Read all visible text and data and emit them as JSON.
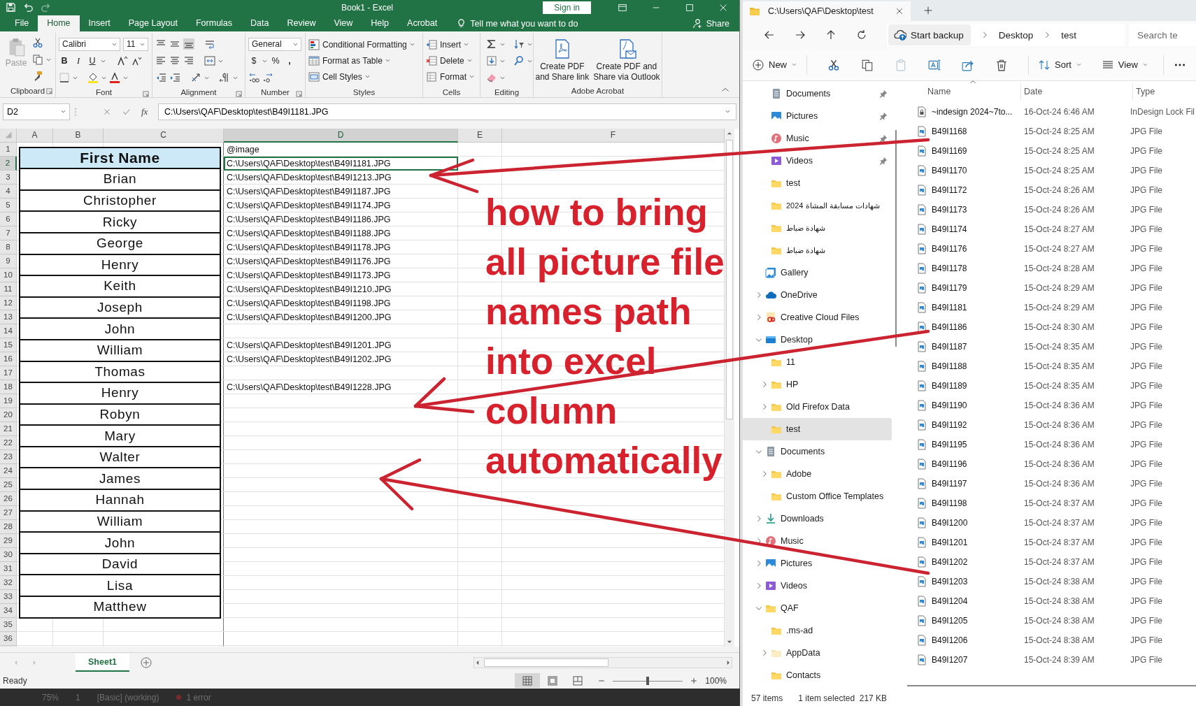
{
  "excel": {
    "title": "Book1 - Excel",
    "sign_in": "Sign in",
    "tabs": [
      {
        "label": "File",
        "selected": false
      },
      {
        "label": "Home",
        "selected": true
      },
      {
        "label": "Insert",
        "selected": false
      },
      {
        "label": "Page Layout",
        "selected": false
      },
      {
        "label": "Formulas",
        "selected": false
      },
      {
        "label": "Data",
        "selected": false
      },
      {
        "label": "Review",
        "selected": false
      },
      {
        "label": "View",
        "selected": false
      },
      {
        "label": "Help",
        "selected": false
      },
      {
        "label": "Acrobat",
        "selected": false
      }
    ],
    "tell_me": "Tell me what you want to do",
    "share": "Share",
    "ribbon": {
      "clipboard": {
        "label": "Clipboard",
        "paste": "Paste"
      },
      "font": {
        "label": "Font",
        "name": "Calibri",
        "size": "11",
        "bold": "B",
        "italic": "I",
        "underline": "U"
      },
      "alignment": {
        "label": "Alignment"
      },
      "number": {
        "label": "Number",
        "format": "General",
        "currency": "$",
        "percent": "%",
        "comma": ","
      },
      "styles": {
        "label": "Styles",
        "items": [
          "Conditional Formatting",
          "Format as Table",
          "Cell Styles"
        ]
      },
      "cells": {
        "label": "Cells",
        "items": [
          "Insert",
          "Delete",
          "Format"
        ]
      },
      "editing": {
        "label": "Editing"
      },
      "acrobat": {
        "label": "Adobe Acrobat",
        "items": [
          "Create PDF\nand Share link",
          "Create PDF and\nShare via Outlook"
        ]
      }
    },
    "name_box": "D2",
    "fx": "fx",
    "formula": "C:\\Users\\QAF\\Desktop\\test\\B49I1181.JPG",
    "columns": [
      {
        "label": "A",
        "selected": false
      },
      {
        "label": "B",
        "selected": false
      },
      {
        "label": "C",
        "selected": false
      },
      {
        "label": "D",
        "selected": true
      },
      {
        "label": "E",
        "selected": false
      },
      {
        "label": "F",
        "selected": false
      }
    ],
    "rows": [
      {
        "number": "1",
        "selected": false,
        "d": "@image"
      },
      {
        "number": "2",
        "selected": true,
        "d": "C:\\Users\\QAF\\Desktop\\test\\B49I1181.JPG"
      },
      {
        "number": "3",
        "selected": false,
        "d": "C:\\Users\\QAF\\Desktop\\test\\B49I1213.JPG"
      },
      {
        "number": "4",
        "selected": false,
        "d": "C:\\Users\\QAF\\Desktop\\test\\B49I1187.JPG"
      },
      {
        "number": "5",
        "selected": false,
        "d": "C:\\Users\\QAF\\Desktop\\test\\B49I1174.JPG"
      },
      {
        "number": "6",
        "selected": false,
        "d": "C:\\Users\\QAF\\Desktop\\test\\B49I1186.JPG"
      },
      {
        "number": "7",
        "selected": false,
        "d": "C:\\Users\\QAF\\Desktop\\test\\B49I1188.JPG"
      },
      {
        "number": "8",
        "selected": false,
        "d": "C:\\Users\\QAF\\Desktop\\test\\B49I1178.JPG"
      },
      {
        "number": "9",
        "selected": false,
        "d": "C:\\Users\\QAF\\Desktop\\test\\B49I1176.JPG"
      },
      {
        "number": "10",
        "selected": false,
        "d": "C:\\Users\\QAF\\Desktop\\test\\B49I1173.JPG"
      },
      {
        "number": "11",
        "selected": false,
        "d": "C:\\Users\\QAF\\Desktop\\test\\B49I1210.JPG"
      },
      {
        "number": "12",
        "selected": false,
        "d": "C:\\Users\\QAF\\Desktop\\test\\B49I1198.JPG"
      },
      {
        "number": "13",
        "selected": false,
        "d": "C:\\Users\\QAF\\Desktop\\test\\B49I1200.JPG"
      },
      {
        "number": "14",
        "selected": false
      },
      {
        "number": "15",
        "selected": false,
        "d": "C:\\Users\\QAF\\Desktop\\test\\B49I1201.JPG"
      },
      {
        "number": "16",
        "selected": false,
        "d": "C:\\Users\\QAF\\Desktop\\test\\B49I1202.JPG"
      },
      {
        "number": "17",
        "selected": false
      },
      {
        "number": "18",
        "selected": false,
        "d": "C:\\Users\\QAF\\Desktop\\test\\B49I1228.JPG"
      },
      {
        "number": "19",
        "selected": false
      },
      {
        "number": "20",
        "selected": false
      },
      {
        "number": "21",
        "selected": false
      },
      {
        "number": "22",
        "selected": false
      },
      {
        "number": "23",
        "selected": false
      },
      {
        "number": "24",
        "selected": false
      },
      {
        "number": "25",
        "selected": false
      },
      {
        "number": "26",
        "selected": false
      },
      {
        "number": "27",
        "selected": false
      },
      {
        "number": "28",
        "selected": false
      },
      {
        "number": "29",
        "selected": false
      },
      {
        "number": "30",
        "selected": false
      },
      {
        "number": "31",
        "selected": false
      },
      {
        "number": "32",
        "selected": false
      },
      {
        "number": "33",
        "selected": false
      },
      {
        "number": "34",
        "selected": false
      },
      {
        "number": "35",
        "selected": false
      },
      {
        "number": "36",
        "selected": false
      }
    ],
    "name_table": {
      "header": "First Name",
      "names": [
        "Brian",
        "Christopher",
        "Ricky",
        "George",
        "Henry",
        "Keith",
        "Joseph",
        "John",
        "William",
        "Thomas",
        "Henry",
        "Robyn",
        "Mary",
        "Walter",
        "James",
        "Hannah",
        "William",
        "John",
        "David",
        "Lisa",
        "Matthew"
      ]
    },
    "sheet_tabs": [
      {
        "label": "Sheet1",
        "selected": true
      }
    ],
    "status": "Ready",
    "zoom_slider": {
      "level": 0.5
    },
    "zoom": "100%"
  },
  "annotation": {
    "lines": [
      "how to bring",
      "all picture file",
      "names path",
      "into excel",
      "column",
      "automatically"
    ]
  },
  "background_window": {
    "items": [
      "75%",
      "1",
      "[Basic] (working)",
      "1 error"
    ]
  },
  "explorer": {
    "tab": {
      "title": "C:\\Users\\QAF\\Desktop\\test"
    },
    "breadcrumb": [
      "Start backup",
      "Desktop",
      "test"
    ],
    "search": {
      "placeholder": "Search te"
    },
    "commands": {
      "new": "New",
      "sort": "Sort",
      "view": "View"
    },
    "quick_access": [
      {
        "label": "Documents",
        "kind": "documents",
        "pinned": true
      },
      {
        "label": "Pictures",
        "kind": "pictures",
        "pinned": true
      },
      {
        "label": "Music",
        "kind": "music",
        "pinned": true
      },
      {
        "label": "Videos",
        "kind": "videos",
        "pinned": true
      },
      {
        "label": "test",
        "kind": "folder",
        "pinned": false
      },
      {
        "label": "شهادات مسابقة المشاة 2024",
        "kind": "folder",
        "pinned": false
      },
      {
        "label": "شهادة ضباط",
        "kind": "folder",
        "pinned": false
      },
      {
        "label": "شهادة ضباط",
        "kind": "folder",
        "pinned": false
      }
    ],
    "tree": [
      {
        "label": "Gallery",
        "kind": "gallery",
        "expandable": false,
        "selected": false
      },
      {
        "label": "OneDrive",
        "kind": "onedrive",
        "expandable": true,
        "expanded": false,
        "selected": false
      },
      {
        "label": "Creative Cloud Files",
        "kind": "creative-cloud",
        "expandable": true,
        "expanded": false,
        "selected": false
      },
      {
        "label": "Desktop",
        "kind": "desktop",
        "expandable": true,
        "expanded": true,
        "selected": false,
        "children": [
          {
            "label": "11",
            "kind": "folder",
            "expandable": false,
            "selected": false
          },
          {
            "label": "HP",
            "kind": "folder",
            "expandable": true,
            "expanded": false,
            "selected": false
          },
          {
            "label": "Old Firefox Data",
            "kind": "folder",
            "expandable": true,
            "expanded": false,
            "selected": false
          },
          {
            "label": "test",
            "kind": "folder",
            "expandable": false,
            "selected": true
          }
        ]
      },
      {
        "label": "Documents",
        "kind": "documents",
        "expandable": true,
        "expanded": true,
        "selected": false,
        "children": [
          {
            "label": "Adobe",
            "kind": "folder",
            "expandable": true,
            "expanded": false,
            "selected": false
          },
          {
            "label": "Custom Office Templates",
            "kind": "folder",
            "expandable": false,
            "selected": false
          }
        ]
      },
      {
        "label": "Downloads",
        "kind": "downloads",
        "expandable": true,
        "expanded": false,
        "selected": false
      },
      {
        "label": "Music",
        "kind": "music",
        "expandable": true,
        "expanded": false,
        "selected": false
      },
      {
        "label": "Pictures",
        "kind": "pictures",
        "expandable": true,
        "expanded": false,
        "selected": false
      },
      {
        "label": "Videos",
        "kind": "videos",
        "expandable": true,
        "expanded": false,
        "selected": false
      },
      {
        "label": "QAF",
        "kind": "folder",
        "expandable": true,
        "expanded": true,
        "selected": false,
        "children": [
          {
            "label": ".ms-ad",
            "kind": "folder",
            "expandable": false,
            "selected": false
          },
          {
            "label": "AppData",
            "kind": "hidden-folder",
            "expandable": true,
            "expanded": false,
            "selected": false
          },
          {
            "label": "Contacts",
            "kind": "folder",
            "expandable": false,
            "selected": false
          }
        ]
      }
    ],
    "columns": [
      "Name",
      "Date",
      "Type"
    ],
    "files": [
      {
        "name": "~indesign 2024~7to...",
        "date": "16-Oct-24 6:46 AM",
        "type": "InDesign Lock Fil",
        "kind": "lock"
      },
      {
        "name": "B49I1168",
        "date": "15-Oct-24 8:25 AM",
        "type": "JPG File",
        "kind": "image"
      },
      {
        "name": "B49I1169",
        "date": "15-Oct-24 8:25 AM",
        "type": "JPG File",
        "kind": "image"
      },
      {
        "name": "B49I1170",
        "date": "15-Oct-24 8:25 AM",
        "type": "JPG File",
        "kind": "image"
      },
      {
        "name": "B49I1172",
        "date": "15-Oct-24 8:26 AM",
        "type": "JPG File",
        "kind": "image"
      },
      {
        "name": "B49I1173",
        "date": "15-Oct-24 8:26 AM",
        "type": "JPG File",
        "kind": "image"
      },
      {
        "name": "B49I1174",
        "date": "15-Oct-24 8:27 AM",
        "type": "JPG File",
        "kind": "image"
      },
      {
        "name": "B49I1176",
        "date": "15-Oct-24 8:27 AM",
        "type": "JPG File",
        "kind": "image"
      },
      {
        "name": "B49I1178",
        "date": "15-Oct-24 8:28 AM",
        "type": "JPG File",
        "kind": "image"
      },
      {
        "name": "B49I1179",
        "date": "15-Oct-24 8:29 AM",
        "type": "JPG File",
        "kind": "image"
      },
      {
        "name": "B49I1181",
        "date": "15-Oct-24 8:29 AM",
        "type": "JPG File",
        "kind": "image"
      },
      {
        "name": "B49I1186",
        "date": "15-Oct-24 8:30 AM",
        "type": "JPG File",
        "kind": "image"
      },
      {
        "name": "B49I1187",
        "date": "15-Oct-24 8:35 AM",
        "type": "JPG File",
        "kind": "image"
      },
      {
        "name": "B49I1188",
        "date": "15-Oct-24 8:35 AM",
        "type": "JPG File",
        "kind": "image"
      },
      {
        "name": "B49I1189",
        "date": "15-Oct-24 8:35 AM",
        "type": "JPG File",
        "kind": "image"
      },
      {
        "name": "B49I1190",
        "date": "15-Oct-24 8:36 AM",
        "type": "JPG File",
        "kind": "image"
      },
      {
        "name": "B49I1192",
        "date": "15-Oct-24 8:36 AM",
        "type": "JPG File",
        "kind": "image"
      },
      {
        "name": "B49I1195",
        "date": "15-Oct-24 8:36 AM",
        "type": "JPG File",
        "kind": "image"
      },
      {
        "name": "B49I1196",
        "date": "15-Oct-24 8:36 AM",
        "type": "JPG File",
        "kind": "image"
      },
      {
        "name": "B49I1197",
        "date": "15-Oct-24 8:36 AM",
        "type": "JPG File",
        "kind": "image"
      },
      {
        "name": "B49I1198",
        "date": "15-Oct-24 8:37 AM",
        "type": "JPG File",
        "kind": "image"
      },
      {
        "name": "B49I1200",
        "date": "15-Oct-24 8:37 AM",
        "type": "JPG File",
        "kind": "image"
      },
      {
        "name": "B49I1201",
        "date": "15-Oct-24 8:37 AM",
        "type": "JPG File",
        "kind": "image"
      },
      {
        "name": "B49I1202",
        "date": "15-Oct-24 8:37 AM",
        "type": "JPG File",
        "kind": "image"
      },
      {
        "name": "B49I1203",
        "date": "15-Oct-24 8:38 AM",
        "type": "JPG File",
        "kind": "image"
      },
      {
        "name": "B49I1204",
        "date": "15-Oct-24 8:38 AM",
        "type": "JPG File",
        "kind": "image"
      },
      {
        "name": "B49I1205",
        "date": "15-Oct-24 8:38 AM",
        "type": "JPG File",
        "kind": "image"
      },
      {
        "name": "B49I1206",
        "date": "15-Oct-24 8:38 AM",
        "type": "JPG File",
        "kind": "image"
      },
      {
        "name": "B49I1207",
        "date": "15-Oct-24 8:39 AM",
        "type": "JPG File",
        "kind": "image"
      }
    ],
    "status": {
      "count": "57 items",
      "selection": "1 item selected  217 KB"
    }
  }
}
